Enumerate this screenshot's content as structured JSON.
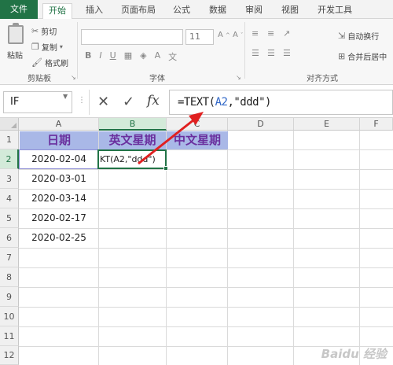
{
  "ribbon_tabs": [
    "文件",
    "开始",
    "插入",
    "页面布局",
    "公式",
    "数据",
    "审阅",
    "视图",
    "开发工具"
  ],
  "clipboard": {
    "paste": "粘贴",
    "cut": "剪切",
    "copy": "复制",
    "format_painter": "格式刷",
    "group": "剪贴板"
  },
  "font": {
    "size": "11",
    "group": "字体"
  },
  "alignment": {
    "wrap": "自动换行",
    "merge": "合并后居中",
    "group": "对齐方式"
  },
  "formula_bar": {
    "name_box": "IF",
    "fx": "fx",
    "formula_prefix": "=TEXT(",
    "formula_ref": "A2",
    "formula_suffix": ",\"ddd\")"
  },
  "columns": [
    "A",
    "B",
    "C",
    "D",
    "E",
    "F"
  ],
  "rows": [
    "1",
    "2",
    "3",
    "4",
    "5",
    "6",
    "7",
    "8",
    "9",
    "10",
    "11",
    "12"
  ],
  "headers": {
    "a1": "日期",
    "b1": "英文星期",
    "c1": "中文星期"
  },
  "dates": [
    "2020-02-04",
    "2020-03-01",
    "2020-03-14",
    "2020-02-17",
    "2020-02-25"
  ],
  "editing_cell": "KT(A2,\"ddd\")",
  "watermark": "Baidu 经验",
  "colors": {
    "accent": "#217346",
    "header_fill": "#a9b8e7",
    "header_text": "#6a2f9e",
    "arrow": "#e02020"
  }
}
